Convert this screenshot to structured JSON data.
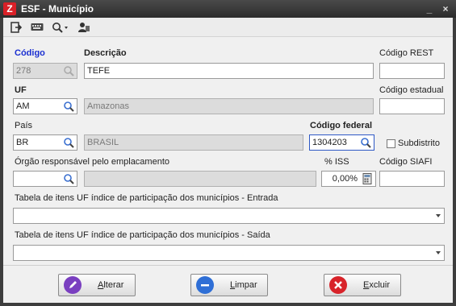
{
  "window": {
    "title": "ESF - Município",
    "minimize_glyph": "_",
    "close_glyph": "×"
  },
  "toolbar": {
    "items": [
      {
        "name": "exit-icon"
      },
      {
        "name": "keyboard-icon"
      },
      {
        "name": "search-dropdown-icon"
      },
      {
        "name": "user-icon"
      }
    ]
  },
  "form": {
    "codigo": {
      "label": "Código",
      "value": "278"
    },
    "descricao": {
      "label": "Descrição",
      "value": "TEFE"
    },
    "codigo_rest": {
      "label": "Código REST",
      "value": ""
    },
    "uf": {
      "label": "UF",
      "value": "AM",
      "description": "Amazonas"
    },
    "codigo_estadual": {
      "label": "Código estadual",
      "value": ""
    },
    "pais": {
      "label": "País",
      "value": "BR",
      "description": "BRASIL"
    },
    "codigo_federal": {
      "label": "Código federal",
      "value": "1304203"
    },
    "subdistrito": {
      "label": "Subdistrito",
      "checked": false
    },
    "orgao": {
      "label": "Órgão responsável pelo emplacamento",
      "value": "",
      "description": ""
    },
    "iss": {
      "label": "% ISS",
      "value": "0,00%"
    },
    "codigo_siafi": {
      "label": "Código SIAFI",
      "value": ""
    },
    "tabela_entrada": {
      "label": "Tabela de itens UF índice de participação dos municípios - Entrada",
      "value": ""
    },
    "tabela_saida": {
      "label": "Tabela de itens UF índice de participação dos municípios - Saída",
      "value": ""
    }
  },
  "buttons": {
    "alterar": "Alterar",
    "limpar": "Limpar",
    "excluir": "Excluir"
  },
  "colors": {
    "required_label": "#1a2fd1",
    "focus_border": "#2e58c5",
    "alterar_icon": "#7a3fc0",
    "limpar_icon": "#2f6fd6",
    "excluir_icon": "#d8232a"
  }
}
